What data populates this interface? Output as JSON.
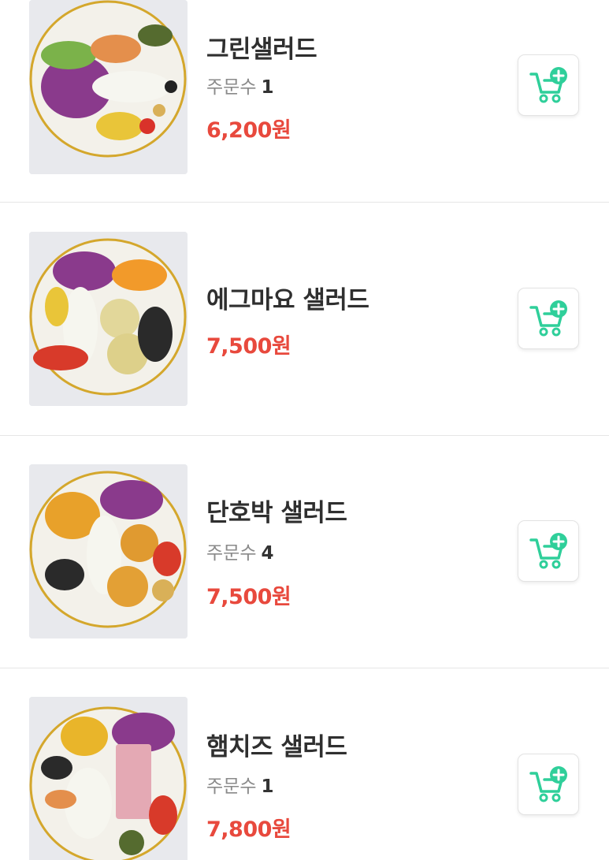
{
  "theme": {
    "price_color": "#e8493d",
    "accent_color": "#2fcf9a",
    "title_color": "#2f2f2f"
  },
  "menu_items": [
    {
      "name": "그린샐러드",
      "orders_label": "주문수",
      "orders_count": "1",
      "price": "6,200원",
      "image": "salad-photo",
      "action_icon": "cart-plus-icon"
    },
    {
      "name": "에그마요 샐러드",
      "price": "7,500원",
      "image": "salad-photo",
      "action_icon": "cart-plus-icon"
    },
    {
      "name": "단호박 샐러드",
      "orders_label": "주문수",
      "orders_count": "4",
      "price": "7,500원",
      "image": "salad-photo",
      "action_icon": "cart-plus-icon"
    },
    {
      "name": "햄치즈 샐러드",
      "orders_label": "주문수",
      "orders_count": "1",
      "price": "7,800원",
      "image": "salad-photo",
      "action_icon": "cart-plus-icon"
    }
  ]
}
